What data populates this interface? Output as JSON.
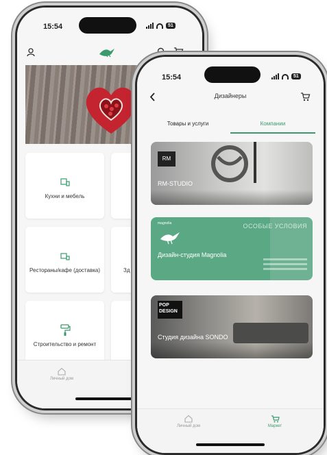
{
  "back_phone": {
    "status": {
      "time": "15:54",
      "battery": "51"
    },
    "header": {
      "logo_icon": "bird-logo-icon",
      "user_icon": "user-icon",
      "search_icon": "search-icon",
      "cart_icon": "cart-icon"
    },
    "categories": [
      {
        "label": "Кухни и мебель",
        "icon": "furniture-icon"
      },
      {
        "label": "Рестораны/кафе (доставка)",
        "icon": "restaurant-icon"
      },
      {
        "label": "Строительство и ремонт",
        "icon": "paint-roller-icon"
      }
    ],
    "partial_label": "Зд",
    "tabbar": {
      "home_label": "Личный дом"
    }
  },
  "front_phone": {
    "status": {
      "time": "15:54",
      "battery": "51"
    },
    "nav": {
      "title": "Дизайнеры",
      "back_icon": "back-chevron-icon",
      "cart_icon": "cart-icon"
    },
    "tabs": {
      "goods": "Товары и услуги",
      "companies": "Компании"
    },
    "companies": [
      {
        "name": "RM-STUDIO",
        "logo": "RM",
        "color": "#8f8f8f"
      },
      {
        "name": "Дизайн-студия Magnolia",
        "logo": "magnolia",
        "overlay_text": "ОСОБЫЕ УСЛОВИЯ",
        "color": "#5aa884"
      },
      {
        "name": "Студия дизайна SONDO",
        "logo": "POP DESIGN",
        "color": "#6e6e6e"
      }
    ],
    "tabbar": {
      "home_label": "Личный дом",
      "market_label": "Маркет"
    }
  },
  "colors": {
    "accent_green": "#3a9a6e",
    "magnolia_green": "#5aa884"
  }
}
